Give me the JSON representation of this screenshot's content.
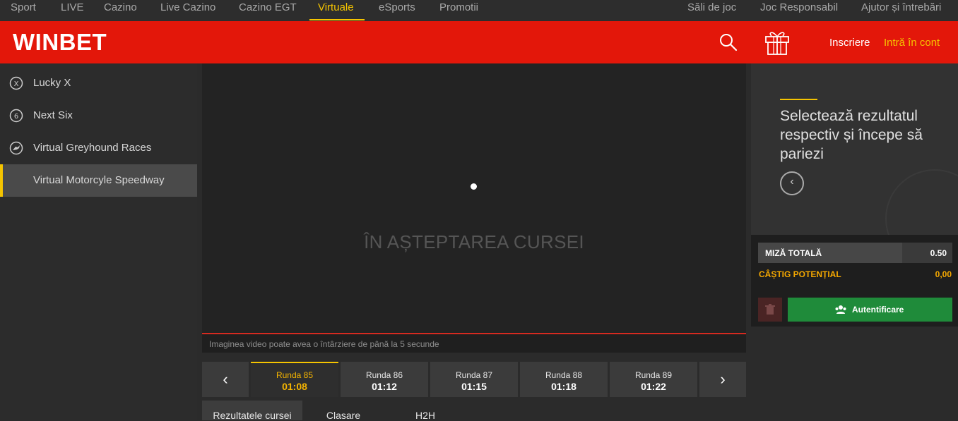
{
  "topnav": {
    "items": [
      "Sport",
      "LIVE",
      "Cazino",
      "Live Cazino",
      "Cazino EGT",
      "Virtuale",
      "eSports",
      "Promotii"
    ],
    "right_items": [
      "Săli de joc",
      "Joc Responsabil",
      "Ajutor și întrebări"
    ],
    "active": "Virtuale"
  },
  "header": {
    "logo": "WINBET",
    "search_icon": "search-icon",
    "gift_icon": "gift-icon",
    "register": "Inscriere",
    "login": "Intră în cont",
    "brand_color": "#e3170a",
    "accent_color": "#f5c400"
  },
  "sidebar": {
    "items": [
      {
        "label": "Lucky X",
        "icon": "lucky-x-icon"
      },
      {
        "label": "Next Six",
        "icon": "next-six-icon"
      },
      {
        "label": "Virtual Greyhound Races",
        "icon": "greyhound-icon"
      },
      {
        "label": "Virtual Motorcyle Speedway",
        "icon": "",
        "active": true
      }
    ]
  },
  "video": {
    "status": "ÎN AȘTEPTAREA CURSEI",
    "delay_note": "Imaginea video poate avea o întârziere de până la 5 secunde"
  },
  "rounds": {
    "items": [
      {
        "label": "Runda 85",
        "time": "01:08",
        "active": true
      },
      {
        "label": "Runda 86",
        "time": "01:12"
      },
      {
        "label": "Runda 87",
        "time": "01:15"
      },
      {
        "label": "Runda 88",
        "time": "01:18"
      },
      {
        "label": "Runda 89",
        "time": "01:22"
      }
    ],
    "prev": "‹",
    "next": "›"
  },
  "tabs": {
    "items": [
      "Rezultatele cursei",
      "Clasare",
      "H2H"
    ],
    "active": "Rezultatele cursei"
  },
  "promo": {
    "text": "Selectează rezultatul respectiv și începe să pariezi",
    "back": "‹"
  },
  "betslip": {
    "stake_label": "MIZĂ TOTALĂ",
    "stake_value": "0.50",
    "win_label": "CÂȘTIG POTENȚIAL",
    "win_value": "0,00",
    "auth_button": "Autentificare"
  }
}
